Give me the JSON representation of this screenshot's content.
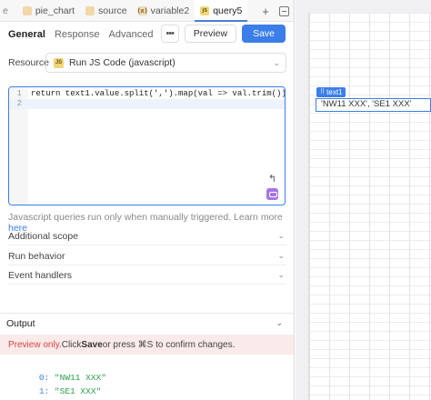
{
  "tabs": [
    {
      "label": "e",
      "icon": "",
      "active": false
    },
    {
      "label": "pie_chart",
      "icon": "chart-badge",
      "active": false
    },
    {
      "label": "source",
      "icon": "chart-badge",
      "active": false
    },
    {
      "label": "variable2",
      "icon": "variable-badge",
      "active": false
    },
    {
      "label": "query5",
      "icon": "js-badge",
      "active": true
    }
  ],
  "tab_icons": {
    "js": "JS",
    "var": "(x)"
  },
  "subtabs": [
    "General",
    "Response",
    "Advanced"
  ],
  "actions": {
    "more": "•••",
    "preview": "Preview",
    "save": "Save",
    "add": "+"
  },
  "resource": {
    "label": "Resource",
    "badge": "JS",
    "value": "Run JS Code (javascript)"
  },
  "editor": {
    "lines": [
      {
        "number": "1",
        "code": "return text1.value.split(',').map(val => val.trim())"
      },
      {
        "number": "2",
        "code": ""
      }
    ]
  },
  "hint": {
    "text": "Javascript queries run only when manually triggered. Learn more ",
    "link": "here"
  },
  "sections": [
    "Additional scope",
    "Run behavior",
    "Event handlers"
  ],
  "output": {
    "title": "Output",
    "banner": {
      "red": "Preview only.",
      "pre": "  Click ",
      "save": "Save",
      "mid": " or press ⌘S to confirm changes."
    },
    "results": [
      {
        "index": "0:",
        "value": "\"NW11 XXX\""
      },
      {
        "index": "1:",
        "value": "\"SE1 XXX\""
      }
    ]
  },
  "canvas": {
    "component_label": "text1",
    "component_value": "'NW11 XXX', 'SE1 XXX'"
  },
  "colors": {
    "accent": "#3b7ee9",
    "banner_bg": "#fbeaea",
    "banner_red": "#d9443f",
    "output_string": "#2a9d4a"
  }
}
